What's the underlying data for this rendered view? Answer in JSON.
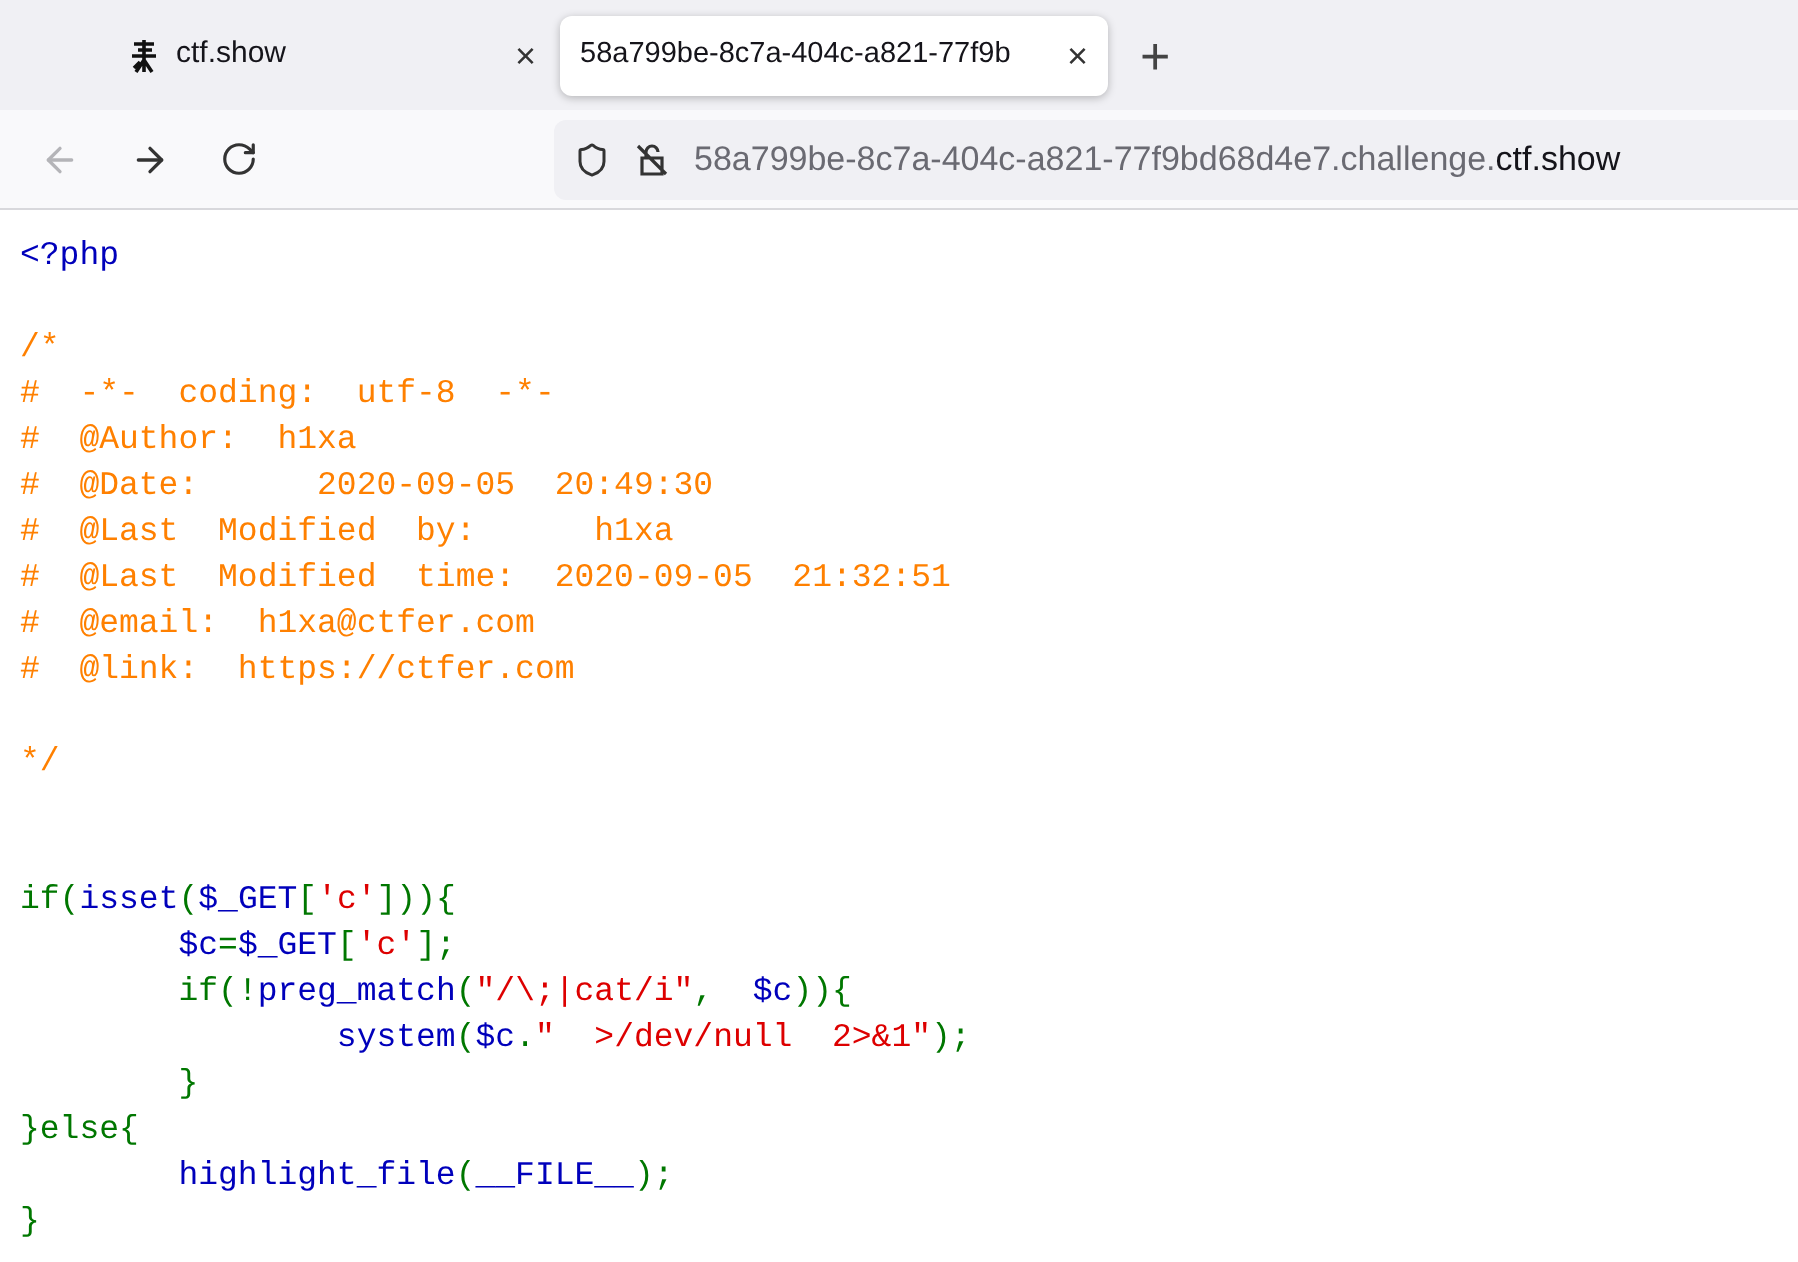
{
  "tabs": [
    {
      "title": "ctf.show",
      "selected": false,
      "close": "×"
    },
    {
      "title": "58a799be-8c7a-404c-a821-77f9b",
      "selected": true,
      "close": "×"
    }
  ],
  "new_tab": "+",
  "nav": {
    "back_disabled": true,
    "forward_disabled": false
  },
  "address_bar": {
    "subdomain": "58a799be-8c7a-404c-a821-77f9bd68d4e7.challenge.",
    "domain": "ctf.show"
  },
  "code_lines": [
    {
      "kind": "code",
      "tokens": [
        {
          "kind": "html",
          "text": "<?php"
        }
      ]
    },
    {
      "kind": "blank"
    },
    {
      "kind": "code",
      "tokens": [
        {
          "kind": "comment",
          "text": "/*"
        }
      ]
    },
    {
      "kind": "code",
      "tokens": [
        {
          "kind": "comment",
          "text": "#  -*-  coding:  utf-8  -*-"
        }
      ]
    },
    {
      "kind": "code",
      "tokens": [
        {
          "kind": "comment",
          "text": "#  @Author:  h1xa"
        }
      ]
    },
    {
      "kind": "code",
      "tokens": [
        {
          "kind": "comment",
          "text": "#  @Date:      2020-09-05  20:49:30"
        }
      ]
    },
    {
      "kind": "code",
      "tokens": [
        {
          "kind": "comment",
          "text": "#  @Last  Modified  by:      h1xa"
        }
      ]
    },
    {
      "kind": "code",
      "tokens": [
        {
          "kind": "comment",
          "text": "#  @Last  Modified  time:  2020-09-05  21:32:51"
        }
      ]
    },
    {
      "kind": "code",
      "tokens": [
        {
          "kind": "comment",
          "text": "#  @email:  h1xa@ctfer.com"
        }
      ]
    },
    {
      "kind": "code",
      "tokens": [
        {
          "kind": "comment",
          "text": "#  @link:  https://ctfer.com"
        }
      ]
    },
    {
      "kind": "blank"
    },
    {
      "kind": "code",
      "tokens": [
        {
          "kind": "comment",
          "text": "*/"
        }
      ]
    },
    {
      "kind": "blank"
    },
    {
      "kind": "blank"
    },
    {
      "kind": "code",
      "tokens": [
        {
          "kind": "keyword",
          "text": "if("
        },
        {
          "kind": "default",
          "text": "isset"
        },
        {
          "kind": "keyword",
          "text": "("
        },
        {
          "kind": "default",
          "text": "$_GET"
        },
        {
          "kind": "keyword",
          "text": "["
        },
        {
          "kind": "string",
          "text": "'c'"
        },
        {
          "kind": "keyword",
          "text": "])){"
        }
      ]
    },
    {
      "kind": "code",
      "tokens": [
        {
          "kind": "default",
          "text": "        $c"
        },
        {
          "kind": "keyword",
          "text": "="
        },
        {
          "kind": "default",
          "text": "$_GET"
        },
        {
          "kind": "keyword",
          "text": "["
        },
        {
          "kind": "string",
          "text": "'c'"
        },
        {
          "kind": "keyword",
          "text": "];"
        }
      ]
    },
    {
      "kind": "code",
      "tokens": [
        {
          "kind": "keyword",
          "text": "        if(!"
        },
        {
          "kind": "default",
          "text": "preg_match"
        },
        {
          "kind": "keyword",
          "text": "("
        },
        {
          "kind": "string",
          "text": "\"/\\;|cat/i\""
        },
        {
          "kind": "keyword",
          "text": ",  "
        },
        {
          "kind": "default",
          "text": "$c"
        },
        {
          "kind": "keyword",
          "text": ")){"
        }
      ]
    },
    {
      "kind": "code",
      "tokens": [
        {
          "kind": "default",
          "text": "                system"
        },
        {
          "kind": "keyword",
          "text": "("
        },
        {
          "kind": "default",
          "text": "$c"
        },
        {
          "kind": "keyword",
          "text": "."
        },
        {
          "kind": "string",
          "text": "\"  >/dev/null  2>&1\""
        },
        {
          "kind": "keyword",
          "text": ");"
        }
      ]
    },
    {
      "kind": "code",
      "tokens": [
        {
          "kind": "keyword",
          "text": "        }"
        }
      ]
    },
    {
      "kind": "code",
      "tokens": [
        {
          "kind": "keyword",
          "text": "}else{"
        }
      ]
    },
    {
      "kind": "code",
      "tokens": [
        {
          "kind": "default",
          "text": "        highlight_file"
        },
        {
          "kind": "keyword",
          "text": "("
        },
        {
          "kind": "default",
          "text": "__FILE__"
        },
        {
          "kind": "keyword",
          "text": ");"
        }
      ]
    },
    {
      "kind": "code",
      "tokens": [
        {
          "kind": "keyword",
          "text": "}"
        }
      ]
    }
  ]
}
